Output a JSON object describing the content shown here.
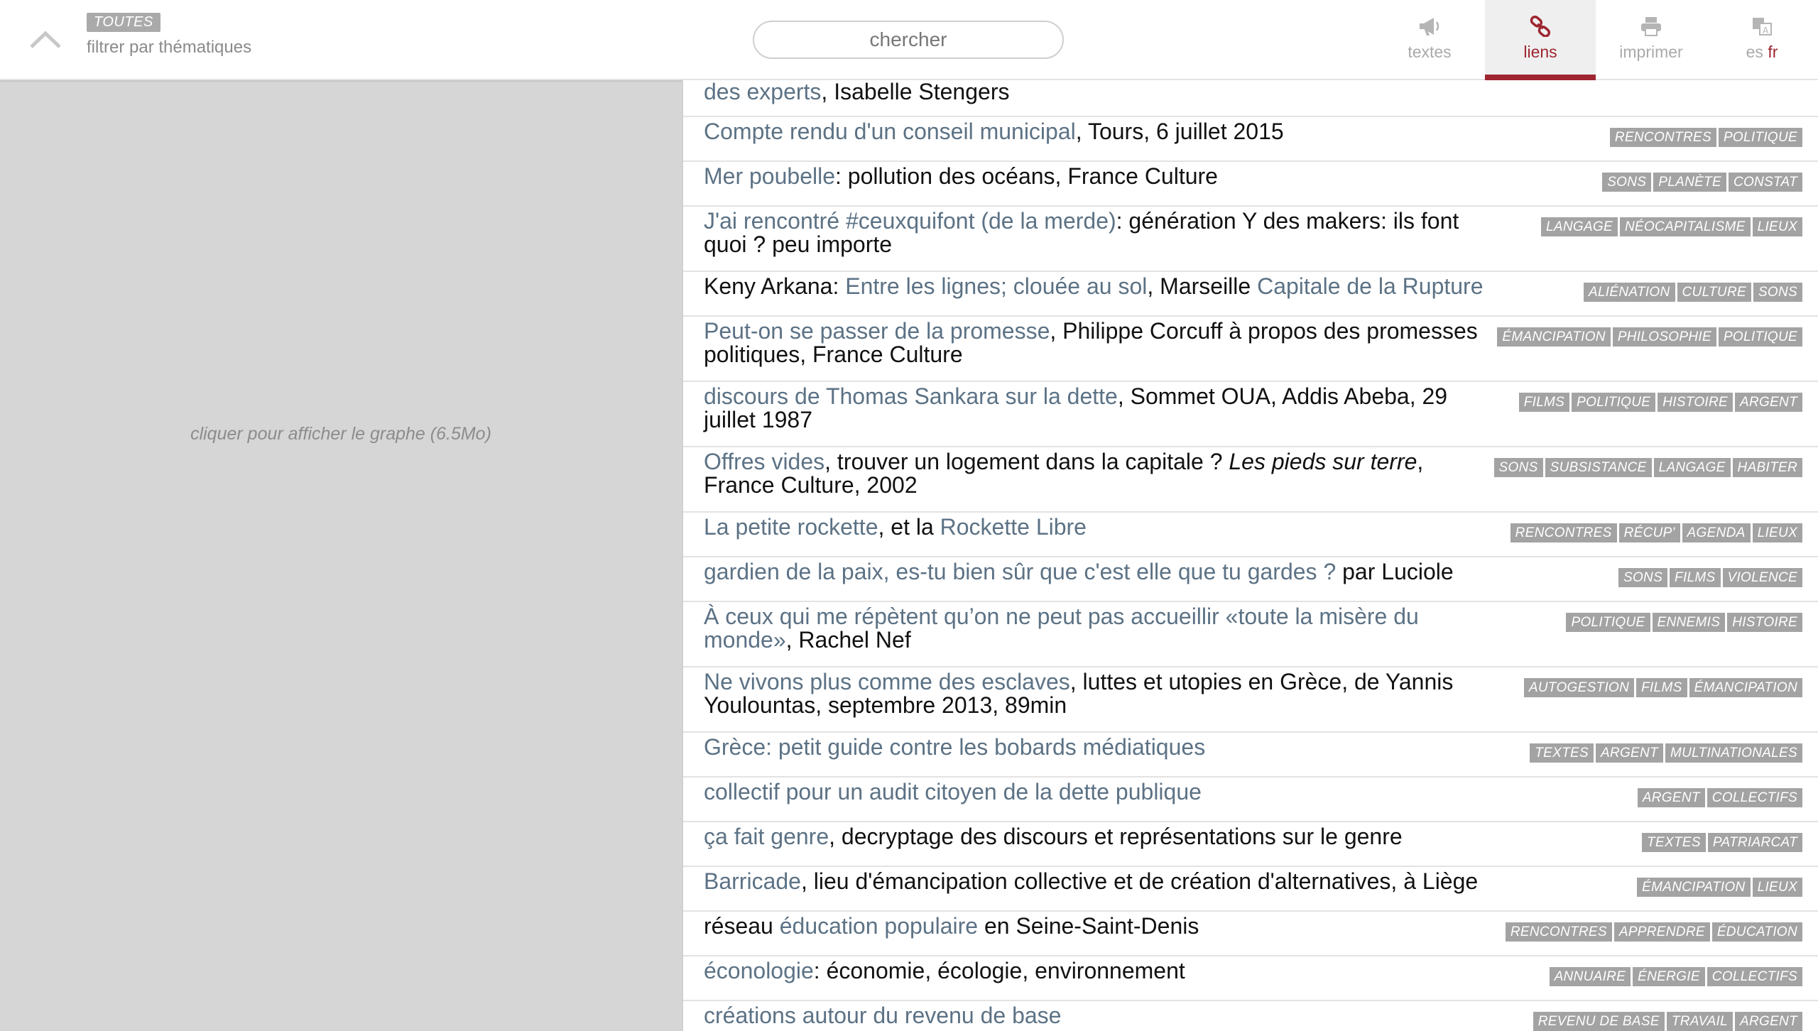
{
  "header": {
    "filter_badge": "TOUTES",
    "filter_label": "filtrer par thématiques",
    "search_placeholder": "chercher",
    "nav": [
      {
        "label": "textes",
        "icon": "megaphone-icon"
      },
      {
        "label": "liens",
        "icon": "link-icon"
      },
      {
        "label": "imprimer",
        "icon": "printer-icon"
      }
    ],
    "lang": {
      "other": "es",
      "current": "fr",
      "icon": "translate-icon"
    },
    "colors": {
      "accent": "#9e2530",
      "link": "#5c7285",
      "tag": "#a3a3a3"
    }
  },
  "graph": {
    "hint": "cliquer pour afficher le graphe (6.5Mo)"
  },
  "rows": [
    {
      "h": 52,
      "parts": [
        {
          "t": "des experts",
          "link": true
        },
        {
          "t": ", Isabelle Stengers"
        }
      ],
      "tags": []
    },
    {
      "h": 63,
      "parts": [
        {
          "t": "Compte rendu d'un conseil municipal",
          "link": true
        },
        {
          "t": ", Tours, 6 juillet 2015"
        }
      ],
      "tags": [
        "RENCONTRES",
        "POLITIQUE"
      ]
    },
    {
      "h": 63,
      "parts": [
        {
          "t": "Mer poubelle",
          "link": true
        },
        {
          "t": ": pollution des océans, France Culture"
        }
      ],
      "tags": [
        "SONS",
        "PLANÈTE",
        "CONSTAT"
      ]
    },
    {
      "h": 92,
      "parts": [
        {
          "t": "J'ai rencontré #ceuxquifont (de la merde)",
          "link": true
        },
        {
          "t": ": génération Y des makers: ils font quoi ? peu importe"
        }
      ],
      "tags": [
        "LANGAGE",
        "NÉOCAPITALISME",
        "LIEUX"
      ]
    },
    {
      "h": 63,
      "parts": [
        {
          "t": "Keny Arkana: "
        },
        {
          "t": "Entre les lignes; clouée au sol",
          "link": true
        },
        {
          "t": ", Marseille "
        },
        {
          "t": "Capitale de la Rupture",
          "link": true
        }
      ],
      "tags": [
        "ALIÉNATION",
        "CULTURE",
        "SONS"
      ]
    },
    {
      "h": 92,
      "parts": [
        {
          "t": "Peut-on se passer de la promesse",
          "link": true
        },
        {
          "t": ", Philippe Corcuff à propos des promesses politiques, France Culture"
        }
      ],
      "tags": [
        "ÉMANCIPATION",
        "PHILOSOPHIE",
        "POLITIQUE"
      ]
    },
    {
      "h": 92,
      "parts": [
        {
          "t": "discours de Thomas Sankara sur la dette",
          "link": true
        },
        {
          "t": ", Sommet OUA, Addis Abeba, 29 juillet 1987"
        }
      ],
      "tags": [
        "FILMS",
        "POLITIQUE",
        "HISTOIRE",
        "ARGENT"
      ]
    },
    {
      "h": 92,
      "parts": [
        {
          "t": "Offres vides",
          "link": true
        },
        {
          "t": ", trouver un logement dans la capitale ? "
        },
        {
          "t": "Les pieds sur terre",
          "italic": true
        },
        {
          "t": ", France Culture, 2002"
        }
      ],
      "tags": [
        "SONS",
        "SUBSISTANCE",
        "LANGAGE",
        "HABITER"
      ]
    },
    {
      "h": 63,
      "parts": [
        {
          "t": "La petite rockette",
          "link": true
        },
        {
          "t": ", et la "
        },
        {
          "t": "Rockette Libre",
          "link": true
        }
      ],
      "tags": [
        "RENCONTRES",
        "RÉCUP'",
        "AGENDA",
        "LIEUX"
      ]
    },
    {
      "h": 63,
      "parts": [
        {
          "t": "gardien de la paix, es-tu bien sûr que c'est elle que tu gardes ?",
          "link": true
        },
        {
          "t": " par Luciole"
        }
      ],
      "tags": [
        "SONS",
        "FILMS",
        "VIOLENCE"
      ]
    },
    {
      "h": 92,
      "parts": [
        {
          "t": "À ceux qui me répètent qu’on ne peut pas accueillir «toute la misère du monde»",
          "link": true
        },
        {
          "t": ", Rachel Nef"
        }
      ],
      "tags": [
        "POLITIQUE",
        "ENNEMIS",
        "HISTOIRE"
      ]
    },
    {
      "h": 92,
      "parts": [
        {
          "t": "Ne vivons plus comme des esclaves",
          "link": true
        },
        {
          "t": ", luttes et utopies en Grèce, de Yannis Youlountas, septembre 2013, 89min"
        }
      ],
      "tags": [
        "AUTOGESTION",
        "FILMS",
        "ÉMANCIPATION"
      ]
    },
    {
      "h": 63,
      "parts": [
        {
          "t": "Grèce: petit guide contre les bobards médiatiques",
          "link": true
        }
      ],
      "tags": [
        "TEXTES",
        "ARGENT",
        "MULTINATIONALES"
      ]
    },
    {
      "h": 63,
      "parts": [
        {
          "t": "collectif pour un audit citoyen de la dette publique",
          "link": true
        }
      ],
      "tags": [
        "ARGENT",
        "COLLECTIFS"
      ]
    },
    {
      "h": 63,
      "parts": [
        {
          "t": "ça fait genre",
          "link": true
        },
        {
          "t": ", decryptage des discours et représentations sur le genre"
        }
      ],
      "tags": [
        "TEXTES",
        "PATRIARCAT"
      ]
    },
    {
      "h": 63,
      "parts": [
        {
          "t": "Barricade",
          "link": true
        },
        {
          "t": ", lieu d'émancipation collective et de création d'alternatives, à Liège"
        }
      ],
      "tags": [
        "ÉMANCIPATION",
        "LIEUX"
      ]
    },
    {
      "h": 63,
      "parts": [
        {
          "t": "réseau "
        },
        {
          "t": "éducation populaire",
          "link": true
        },
        {
          "t": " en Seine-Saint-Denis"
        }
      ],
      "tags": [
        "RENCONTRES",
        "APPRENDRE",
        "ÉDUCATION"
      ]
    },
    {
      "h": 63,
      "parts": [
        {
          "t": "éconologie",
          "link": true
        },
        {
          "t": ": économie, écologie, environnement"
        }
      ],
      "tags": [
        "ANNUAIRE",
        "ÉNERGIE",
        "COLLECTIFS"
      ]
    },
    {
      "h": 63,
      "parts": [
        {
          "t": "créations autour du revenu de base",
          "link": true
        }
      ],
      "tags": [
        "REVENU DE BASE",
        "TRAVAIL",
        "ARGENT"
      ]
    }
  ]
}
